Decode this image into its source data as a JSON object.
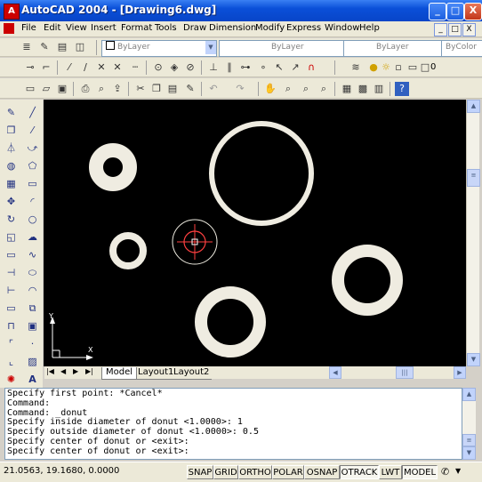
{
  "window": {
    "title": "AutoCAD 2004 - [Drawing6.dwg]",
    "app_icon": "A"
  },
  "window_controls": {
    "minimize": "_",
    "maximize": "□",
    "close": "X"
  },
  "menu": [
    "File",
    "Edit",
    "View",
    "Insert",
    "Format",
    "Tools",
    "Draw",
    "Dimension",
    "Modify",
    "Express",
    "Window",
    "Help"
  ],
  "properties_toolbar": {
    "layer_combo": "ByLayer",
    "color_combo": "ByLayer",
    "linetype_combo": "ByLayer",
    "lineweight_combo": "ByLayer",
    "plotstyle_combo": "ByColor"
  },
  "layer_value": "0",
  "layout_tabs": [
    "Model",
    "Layout1",
    "Layout2"
  ],
  "ucs": {
    "x_label": "X",
    "y_label": "Y"
  },
  "command_lines": [
    "Specify first point: *Cancel*",
    "Command:",
    "Command: _donut",
    "Specify inside diameter of donut <1.0000>: 1",
    "Specify outside diameter of donut <1.0000>: 0.5",
    "Specify center of donut or <exit>:",
    "Specify center of donut or <exit>:"
  ],
  "coordinates": "21.0563, 19.1680, 0.0000",
  "status_buttons": [
    "SNAP",
    "GRID",
    "ORTHO",
    "POLAR",
    "OSNAP",
    "OTRACK",
    "LWT",
    "MODEL"
  ],
  "status_active": [
    "OTRACK",
    "MODEL"
  ],
  "colors": {
    "drawing_bg": "#000000",
    "donut": "#efece1",
    "cursor": "#ff4040",
    "titlebar": "#0a4fd8"
  }
}
